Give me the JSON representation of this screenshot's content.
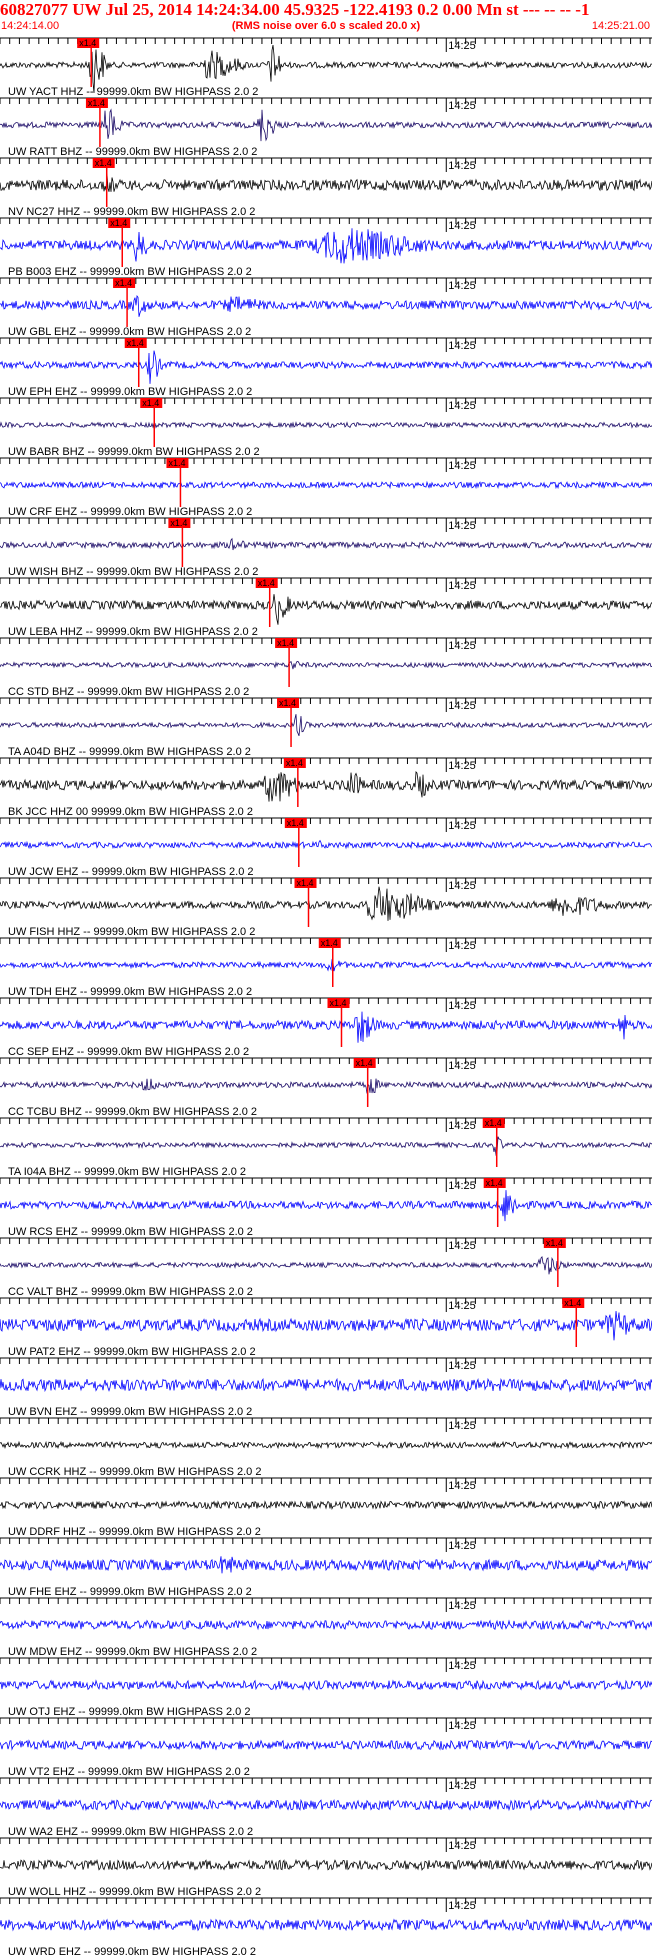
{
  "header": {
    "title": "60827077 UW Jul 25, 2014 14:24:34.00   45.9325 -122.4193  0.2 0.00 Mn st --- -- --   -1",
    "start_time": "14:24:14.00",
    "scale_note": "(RMS noise over 6.0 s scaled 20.0 x)",
    "end_time": "14:25:21.00"
  },
  "chart_data": {
    "type": "line",
    "x_range_seconds": [
      0,
      67
    ],
    "tick_interval_seconds": 1,
    "minute_marker": {
      "label": "14:25",
      "t": 46
    },
    "pick_label": "x1.4",
    "colors": {
      "black": "#000000",
      "blue": "#0000ff",
      "navy": "#1a0a66",
      "pick": "#ff0000"
    },
    "traces": [
      {
        "label": "UW YACT HHZ -- 99999.0km BW  HIGHPASS  2.0  2",
        "color": "black",
        "pick": 9.4,
        "bursts": [
          [
            9.5,
            2,
            1.3
          ],
          [
            21.5,
            5,
            0.7
          ],
          [
            28,
            1.5,
            1.0
          ]
        ],
        "base": 0.12
      },
      {
        "label": "UW RATT BHZ -- 99999.0km BW  HIGHPASS  2.0  2",
        "color": "navy",
        "pick": 10.3,
        "bursts": [
          [
            11,
            2,
            0.9
          ],
          [
            27,
            2,
            0.9
          ],
          [
            63,
            1,
            0.3
          ]
        ],
        "base": 0.12
      },
      {
        "label": "NV NC27 HHZ -- 99999.0km BW  HIGHPASS  2.0  2",
        "color": "black",
        "pick": 11.0,
        "bursts": [
          [
            11,
            2,
            0.5
          ]
        ],
        "base": 0.22
      },
      {
        "label": "PB B003 EHZ -- 99999.0km BW  HIGHPASS  2.0  2",
        "color": "blue",
        "pick": 12.6,
        "bursts": [
          [
            14,
            2,
            0.8
          ],
          [
            35,
            13,
            0.85
          ]
        ],
        "base": 0.2
      },
      {
        "label": "UW GBL EHZ -- 99999.0km BW  HIGHPASS  2.0  2",
        "color": "blue",
        "pick": 13.1,
        "bursts": [
          [
            14,
            2,
            0.6
          ],
          [
            24,
            6,
            0.4
          ]
        ],
        "base": 0.18
      },
      {
        "label": "UW EPH EHZ -- 99999.0km BW  HIGHPASS  2.0  2",
        "color": "blue",
        "pick": 14.3,
        "bursts": [
          [
            15.5,
            1.5,
            0.9
          ]
        ],
        "base": 0.14
      },
      {
        "label": "UW BABR BHZ -- 99999.0km BW  HIGHPASS  2.0  2",
        "color": "navy",
        "pick": 15.9,
        "bursts": [],
        "base": 0.1
      },
      {
        "label": "UW CRF EHZ -- 99999.0km BW  HIGHPASS  2.0  2",
        "color": "blue",
        "pick": 18.6,
        "bursts": [],
        "base": 0.12
      },
      {
        "label": "UW WISH BHZ -- 99999.0km BW  HIGHPASS  2.0  2",
        "color": "navy",
        "pick": 18.8,
        "bursts": [
          [
            24,
            2,
            0.4
          ]
        ],
        "base": 0.12
      },
      {
        "label": "UW LEBA HHZ -- 99999.0km BW  HIGHPASS  2.0  2",
        "color": "black",
        "pick": 27.8,
        "bursts": [
          [
            28.5,
            2,
            0.9
          ]
        ],
        "base": 0.18
      },
      {
        "label": "CC STD BHZ -- 99999.0km BW  HIGHPASS  2.0  2",
        "color": "navy",
        "pick": 29.8,
        "bursts": [
          [
            30,
            1.5,
            0.3
          ]
        ],
        "base": 0.1
      },
      {
        "label": "TA A04D BHZ -- 99999.0km BW  HIGHPASS  2.0  2",
        "color": "navy",
        "pick": 30.0,
        "bursts": [
          [
            30.5,
            1.5,
            0.6
          ]
        ],
        "base": 0.1
      },
      {
        "label": "BK JCC HHZ 00 99999.0km BW  HIGHPASS  2.0  2",
        "color": "black",
        "pick": 30.7,
        "bursts": [
          [
            28,
            4,
            0.9
          ],
          [
            36,
            2,
            0.8
          ],
          [
            43,
            2,
            0.7
          ]
        ],
        "base": 0.2
      },
      {
        "label": "UW JCW EHZ -- 99999.0km BW  HIGHPASS  2.0  2",
        "color": "blue",
        "pick": 30.8,
        "bursts": [
          [
            33,
            2,
            0.2
          ]
        ],
        "base": 0.12
      },
      {
        "label": "UW FISH HHZ -- 99999.0km BW  HIGHPASS  2.0  2",
        "color": "black",
        "pick": 31.8,
        "bursts": [
          [
            39,
            8,
            0.85
          ],
          [
            58,
            7,
            0.55
          ]
        ],
        "base": 0.15
      },
      {
        "label": "UW TDH EHZ -- 99999.0km BW  HIGHPASS  2.0  2",
        "color": "blue",
        "pick": 34.3,
        "bursts": [
          [
            34,
            3,
            0.3
          ]
        ],
        "base": 0.12
      },
      {
        "label": "CC SEP EHZ -- 99999.0km BW  HIGHPASS  2.0  2",
        "color": "blue",
        "pick": 35.2,
        "bursts": [
          [
            37,
            2.5,
            0.9
          ],
          [
            64,
            1,
            1.0
          ]
        ],
        "base": 0.18
      },
      {
        "label": "CC TCBU BHZ -- 99999.0km BW  HIGHPASS  2.0  2",
        "color": "navy",
        "pick": 37.9,
        "bursts": [
          [
            15,
            2,
            0.4
          ],
          [
            38,
            1.5,
            0.6
          ]
        ],
        "base": 0.12
      },
      {
        "label": "TA I04A BHZ -- 99999.0km BW  HIGHPASS  2.0  2",
        "color": "navy",
        "pick": 51.2,
        "bursts": [
          [
            51,
            1.2,
            0.5
          ]
        ],
        "base": 0.1
      },
      {
        "label": "UW RCS EHZ -- 99999.0km BW  HIGHPASS  2.0  2",
        "color": "blue",
        "pick": 51.3,
        "bursts": [
          [
            52,
            2,
            0.9
          ]
        ],
        "base": 0.16
      },
      {
        "label": "CC VALT BHZ -- 99999.0km BW  HIGHPASS  2.0  2",
        "color": "navy",
        "pick": 57.5,
        "bursts": [
          [
            56,
            3,
            0.5
          ]
        ],
        "base": 0.1
      },
      {
        "label": "UW PAT2 EHZ -- 99999.0km BW  HIGHPASS  2.0  2",
        "color": "blue",
        "pick": 59.4,
        "bursts": [
          [
            63,
            4,
            0.7
          ]
        ],
        "base": 0.25
      },
      {
        "label": "UW BVN EHZ -- 99999.0km BW  HIGHPASS  2.0  2",
        "color": "blue",
        "pick": null,
        "bursts": [],
        "base": 0.25
      },
      {
        "label": "UW CCRK HHZ -- 99999.0km BW  HIGHPASS  2.0  2",
        "color": "black",
        "pick": null,
        "bursts": [],
        "base": 0.12
      },
      {
        "label": "UW DDRF HHZ -- 99999.0km BW  HIGHPASS  2.0  2",
        "color": "black",
        "pick": null,
        "bursts": [],
        "base": 0.15
      },
      {
        "label": "UW FHE EHZ -- 99999.0km BW  HIGHPASS  2.0  2",
        "color": "blue",
        "pick": null,
        "bursts": [
          [
            23,
            4,
            0.45
          ]
        ],
        "base": 0.22
      },
      {
        "label": "UW MDW EHZ -- 99999.0km BW  HIGHPASS  2.0  2",
        "color": "blue",
        "pick": null,
        "bursts": [],
        "base": 0.18
      },
      {
        "label": "UW OTJ EHZ -- 99999.0km BW  HIGHPASS  2.0  2",
        "color": "blue",
        "pick": null,
        "bursts": [],
        "base": 0.18
      },
      {
        "label": "UW VT2 EHZ -- 99999.0km BW  HIGHPASS  2.0  2",
        "color": "blue",
        "pick": null,
        "bursts": [],
        "base": 0.18
      },
      {
        "label": "UW WA2 EHZ -- 99999.0km BW  HIGHPASS  2.0  2",
        "color": "blue",
        "pick": null,
        "bursts": [],
        "base": 0.2
      },
      {
        "label": "UW WOLL HHZ -- 99999.0km BW  HIGHPASS  2.0  2",
        "color": "black",
        "pick": null,
        "bursts": [],
        "base": 0.2
      },
      {
        "label": "UW WRD EHZ -- 99999.0km BW  HIGHPASS  2.0  2",
        "color": "blue",
        "pick": null,
        "bursts": [],
        "base": 0.22
      }
    ]
  }
}
